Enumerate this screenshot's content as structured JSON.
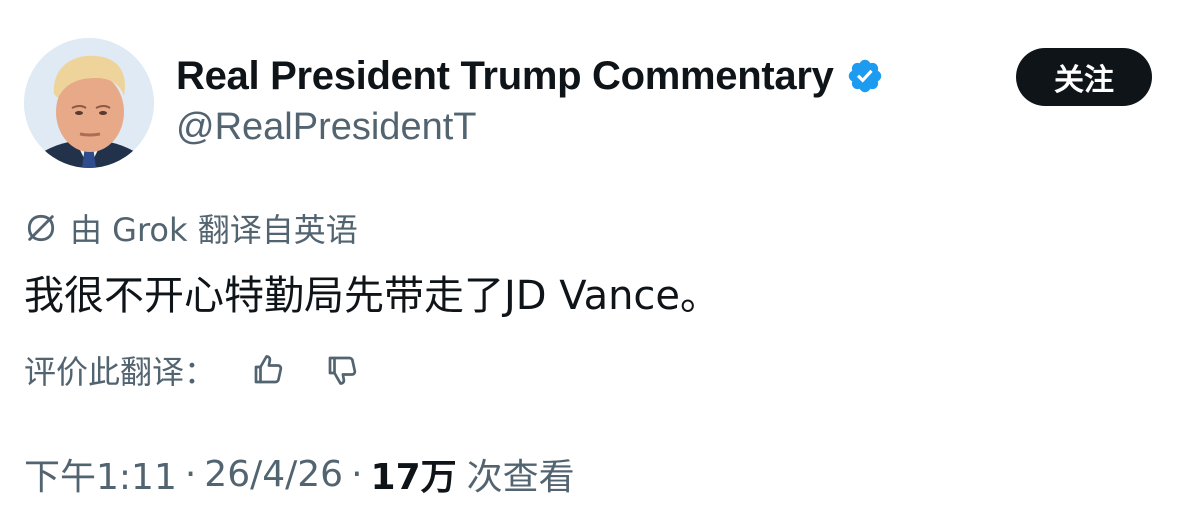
{
  "author": {
    "display_name": "Real President Trump Commentary",
    "handle": "@RealPresidentT",
    "avatar_icon": "profile-photo",
    "verified_icon": "verified-badge-icon",
    "verified_color": "#1d9bf0"
  },
  "follow_button": {
    "label": "关注",
    "background": "#0f1419",
    "text_color": "#ffffff"
  },
  "translation": {
    "icon": "translate-icon",
    "label": "由 Grok 翻译自英语"
  },
  "tweet": {
    "text": "我很不开心特勤局先带走了JD Vance。"
  },
  "rating": {
    "label": "评价此翻译：",
    "thumbs_up_icon": "thumbs-up-icon",
    "thumbs_down_icon": "thumbs-down-icon"
  },
  "meta": {
    "time": "下午1:11",
    "date": "26/4/26",
    "separator": "·",
    "views_count": "17万",
    "views_label": "次查看"
  },
  "colors": {
    "primary_text": "#0f1419",
    "secondary_text": "#536471"
  }
}
